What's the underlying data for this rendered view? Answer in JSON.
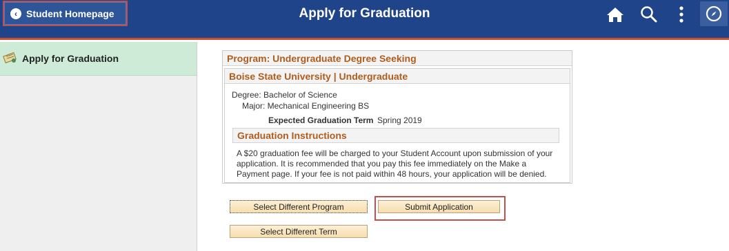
{
  "header": {
    "back_label": "Student Homepage",
    "title": "Apply for Graduation",
    "icons": [
      "home-icon",
      "search-icon",
      "more-vertical-icon",
      "navbar-compass-icon"
    ],
    "bg_color": "#1f4489",
    "accent_color": "#c9502c"
  },
  "sidebar": {
    "items": [
      {
        "label": "Apply for Graduation",
        "icon": "diploma-icon"
      }
    ]
  },
  "program": {
    "heading": "Program: Undergraduate Degree Seeking",
    "institution_heading": "Boise State University | Undergraduate",
    "degree_line": "Degree: Bachelor of Science",
    "major_line": "Major: Mechanical Engineering BS",
    "term_label": "Expected Graduation Term",
    "term_value": "Spring 2019",
    "instructions_heading": "Graduation Instructions",
    "instructions_text": "A $20 graduation fee will be charged to your Student Account upon submission of your application. It is recommended that you pay this fee immediately on the Make a Payment page. If your fee is not paid within 48 hours, your application will be denied."
  },
  "buttons": {
    "select_program": "Select Different Program",
    "submit": "Submit Application",
    "select_term": "Select Different Term"
  }
}
